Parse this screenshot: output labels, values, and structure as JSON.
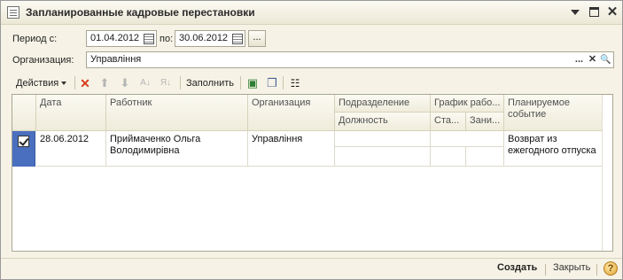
{
  "window": {
    "title": "Запланированные кадровые перестановки"
  },
  "filters": {
    "period_label": "Период с:",
    "date_from": "01.04.2012",
    "to_label": "по:",
    "date_to": "30.06.2012",
    "ellipsis": "...",
    "org_label": "Организация:",
    "org_value": "Управління",
    "org_dots": "...",
    "org_clear": "✕",
    "org_search": "🔍"
  },
  "toolbar": {
    "actions_label": "Действия",
    "fill_label": "Заполнить"
  },
  "table": {
    "headers": {
      "date": "Дата",
      "worker": "Работник",
      "org": "Организация",
      "dept": "Подразделение",
      "position": "Должность",
      "schedule": "График рабо...",
      "rate": "Ста...",
      "occupied": "Зани...",
      "event": "Планируемое событие"
    },
    "rows": [
      {
        "checked": true,
        "date": "28.06.2012",
        "worker": "Приймаченко Ольга Володимирівна",
        "org": "Управління",
        "dept": "",
        "position": "",
        "rate": "",
        "occupied": "",
        "event": "Возврат из ежегодного отпуска"
      }
    ]
  },
  "footer": {
    "create_label": "Создать",
    "close_label": "Закрыть",
    "help_label": "?"
  },
  "icons": {
    "delete": "delete-icon",
    "move_up": "arrow-up-icon",
    "move_down": "arrow-down-icon",
    "sort_asc": "sort-asc-icon",
    "sort_desc": "sort-desc-icon",
    "select_all": "check-all-icon",
    "copy": "copy-icon",
    "settings": "columns-settings-icon"
  }
}
